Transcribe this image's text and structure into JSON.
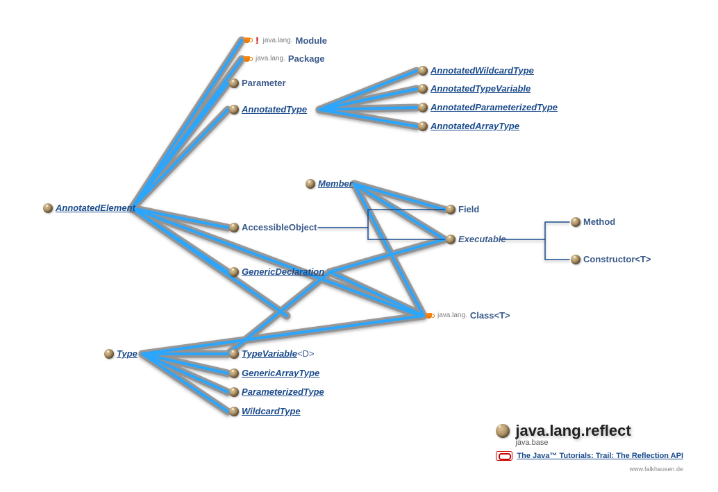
{
  "nodes": {
    "annotatedElement": "AnnotatedElement",
    "module": "Module",
    "modulePkg": "java.lang.",
    "package": "Package",
    "packagePkg": "java.lang.",
    "parameter": "Parameter",
    "annotatedType": "AnnotatedType",
    "annotatedWildcardType": "AnnotatedWildcardType",
    "annotatedTypeVariable": "AnnotatedTypeVariable",
    "annotatedParameterizedType": "AnnotatedParameterizedType",
    "annotatedArrayType": "AnnotatedArrayType",
    "member": "Member",
    "accessibleObject": "AccessibleObject",
    "genericDeclaration": "GenericDeclaration",
    "field": "Field",
    "executable": "Executable",
    "method": "Method",
    "constructor": "Constructor<T>",
    "className": "Class<T>",
    "classPkg": "java.lang.",
    "type": "Type",
    "typeVariable": "TypeVariable",
    "typeVariableParam": "<D>",
    "genericArrayType": "GenericArrayType",
    "parameterizedType": "ParameterizedType",
    "wildcardType": "WildcardType"
  },
  "title": {
    "main": "java.lang.reflect",
    "module": "java.base",
    "tutorial": "The Java™ Tutorials: Trail: The Reflection API",
    "credit": "www.falkhausen.de"
  }
}
